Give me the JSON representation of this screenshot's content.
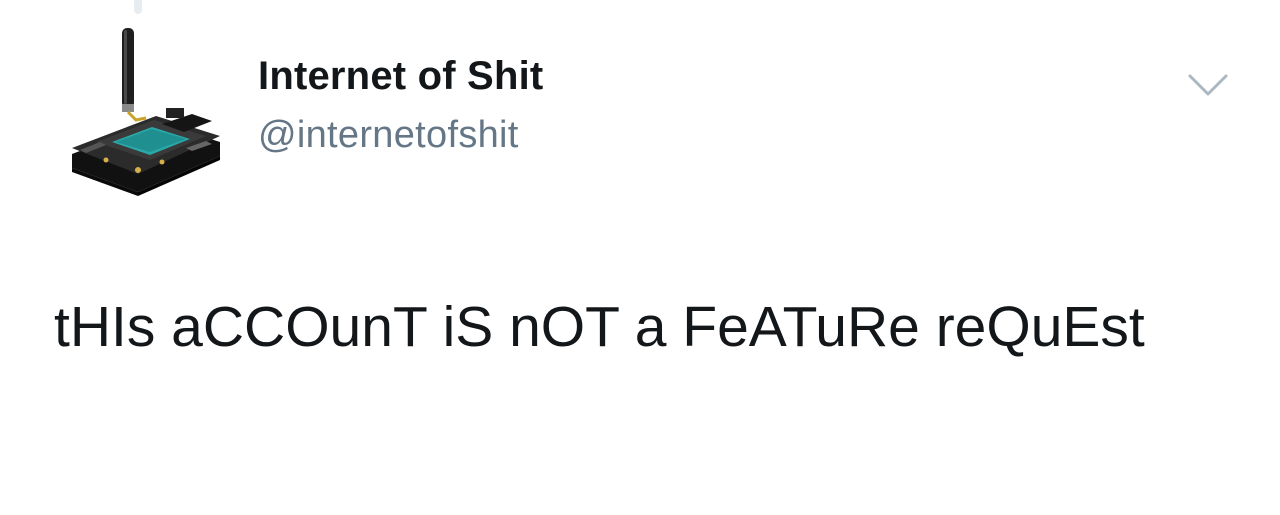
{
  "tweet": {
    "author": {
      "display_name": "Internet of Shit",
      "handle": "@internetofshit",
      "avatar_icon": "circuit-board-with-antenna"
    },
    "text": "tHIs aCCOunT iS nOT a FeATuRe reQuEst",
    "menu_icon": "chevron-down-icon"
  },
  "colors": {
    "name": "#14171a",
    "handle": "#657786",
    "text": "#14171a",
    "caret": "#aab8c2",
    "background": "#ffffff"
  }
}
